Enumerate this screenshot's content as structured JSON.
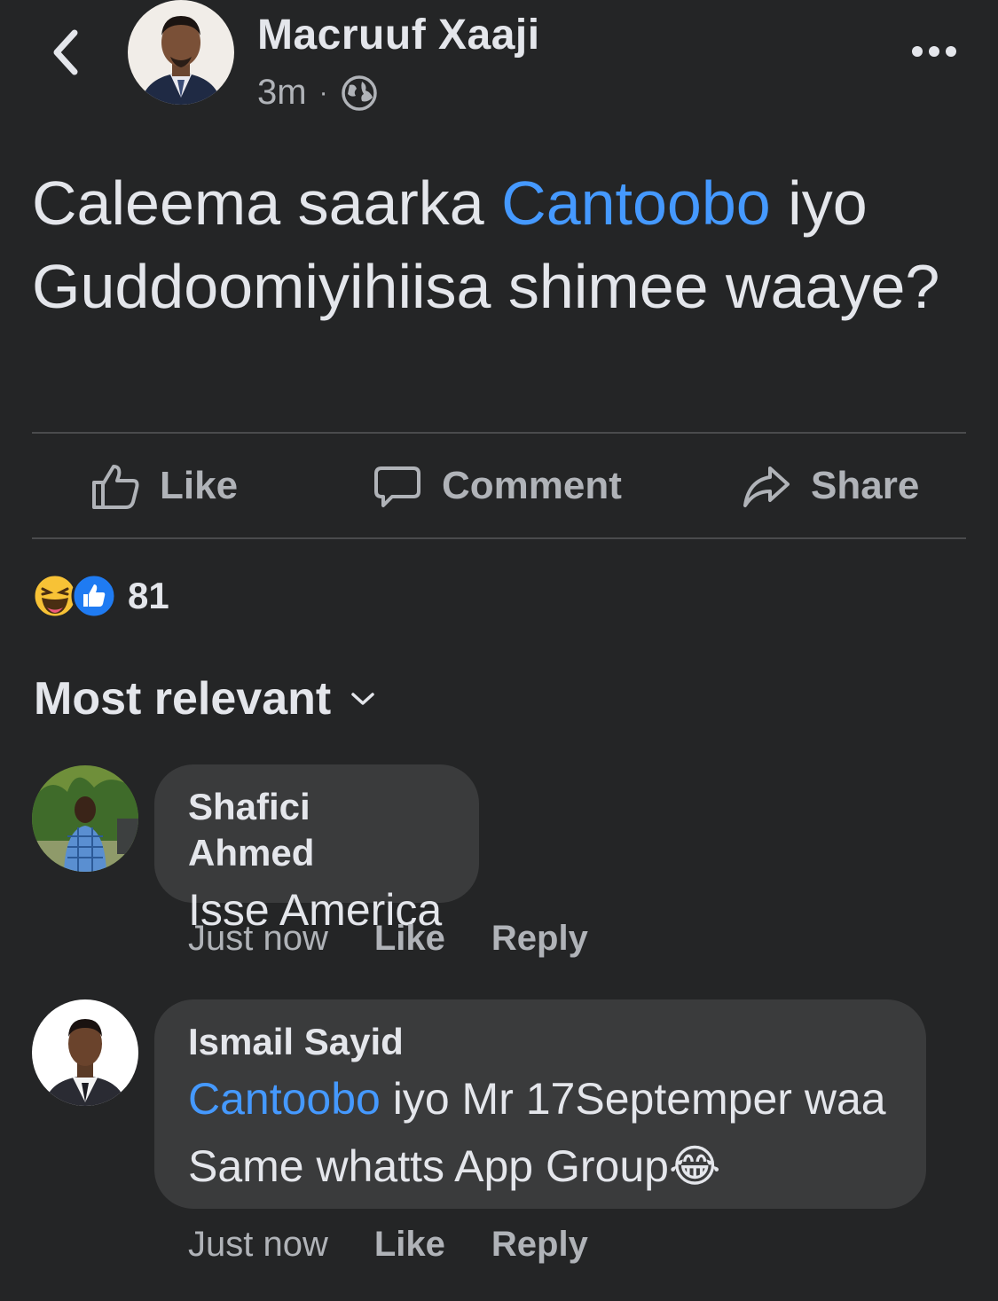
{
  "post": {
    "author": "Macruuf Xaaji",
    "time": "3m",
    "separator": "·",
    "privacy_icon": "globe-icon",
    "text_part1": "Caleema saarka ",
    "text_link": "Cantoobo",
    "text_part2": " iyo Guddoomiyihiisa shimee waaye?"
  },
  "actions": {
    "like": "Like",
    "comment": "Comment",
    "share": "Share"
  },
  "reactions": {
    "icons": [
      "haha-reaction-icon",
      "like-reaction-icon"
    ],
    "count": "81"
  },
  "sort": {
    "label": "Most relevant"
  },
  "comments": [
    {
      "name": "Shafici Ahmed",
      "text_link": "Isse America",
      "time": "Just now",
      "like": "Like",
      "reply": "Reply"
    },
    {
      "name": "Ismail Sayid",
      "text_link": "Cantoobo",
      "text_line1": " iyo Mr 17Septemper waa",
      "text_line2": "Same whatts App Group",
      "emoji": "😂",
      "time": "Just now",
      "like": "Like",
      "reply": "Reply"
    }
  ],
  "colors": {
    "background": "#242526",
    "bubble": "#3a3b3c",
    "link": "#4599ff",
    "text": "#e4e6eb",
    "secondary": "#b0b3b8"
  }
}
